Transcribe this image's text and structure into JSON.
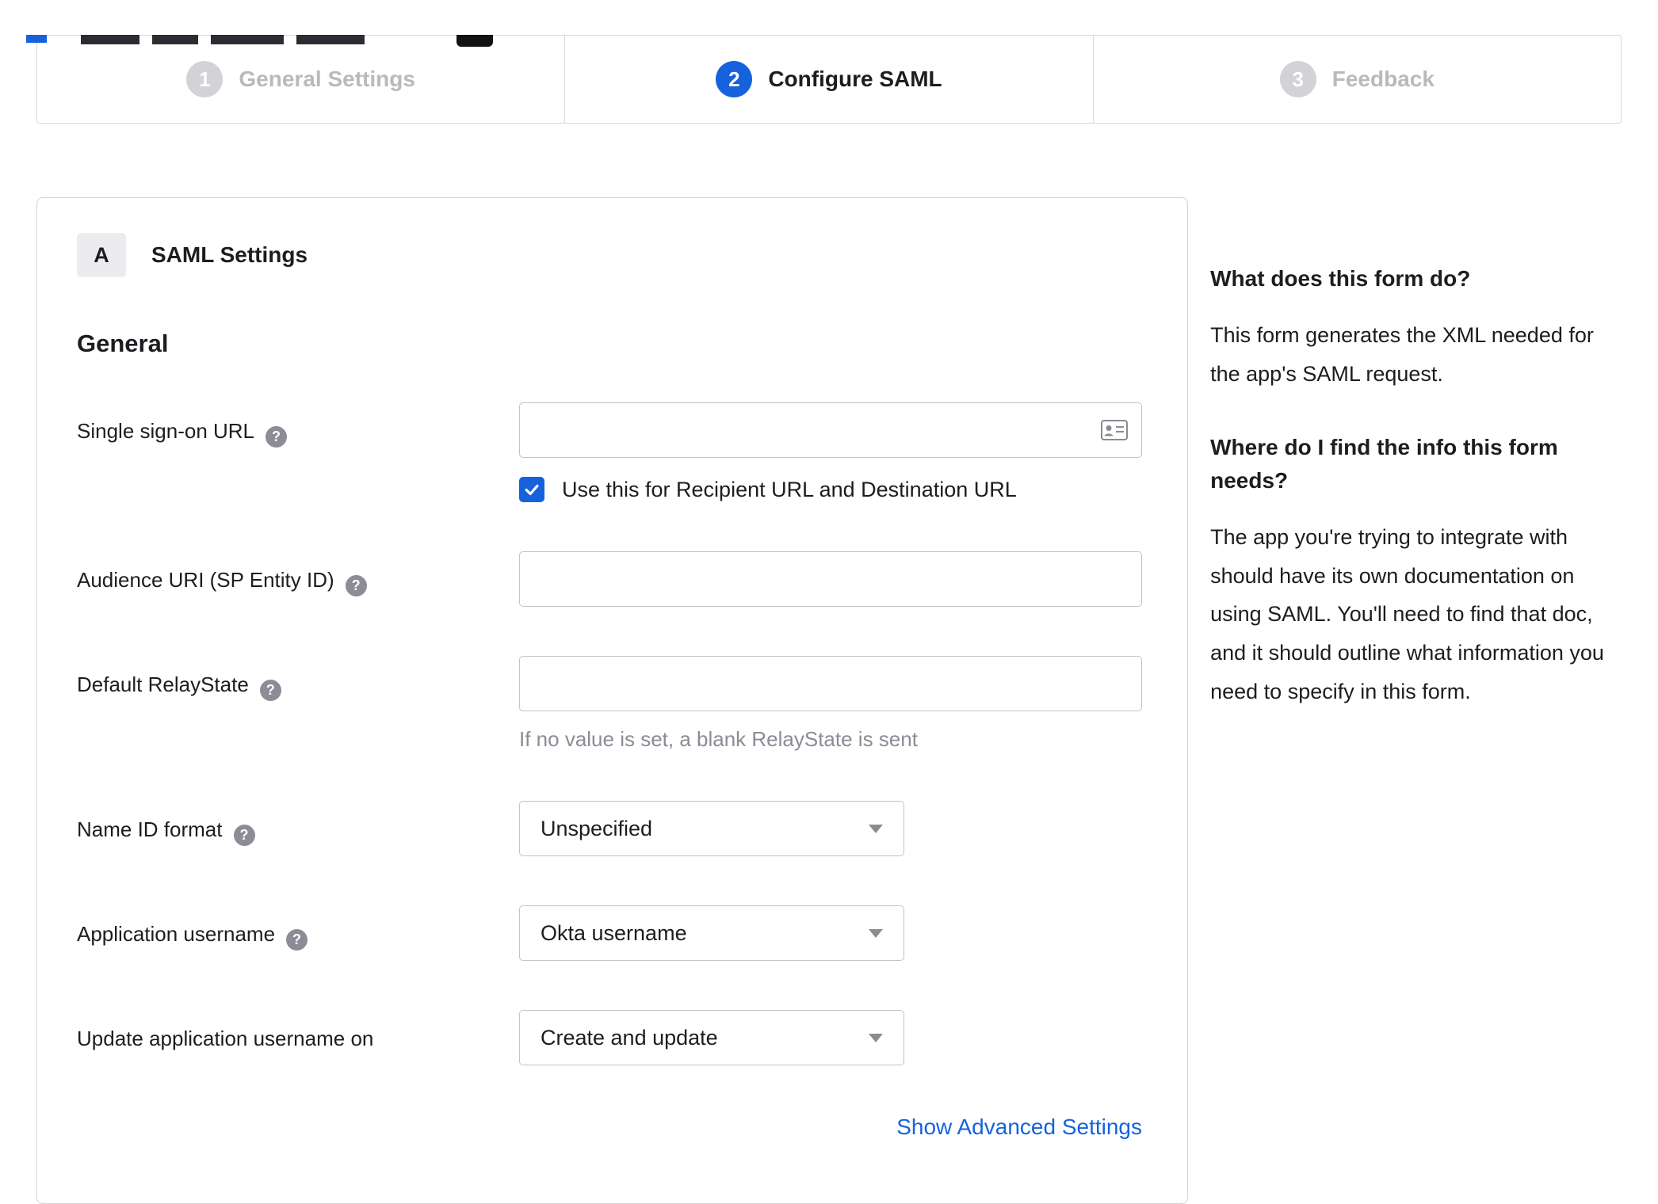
{
  "stepper": {
    "steps": [
      {
        "number": "1",
        "label": "General Settings",
        "active": false
      },
      {
        "number": "2",
        "label": "Configure SAML",
        "active": true
      },
      {
        "number": "3",
        "label": "Feedback",
        "active": false
      }
    ]
  },
  "panel": {
    "badge": "A",
    "title": "SAML Settings",
    "section_heading": "General",
    "fields": {
      "sso_url": {
        "label": "Single sign-on URL",
        "value": "",
        "checkbox_label": "Use this for Recipient URL and Destination URL",
        "checkbox_checked": true
      },
      "audience": {
        "label": "Audience URI (SP Entity ID)",
        "value": ""
      },
      "relay_state": {
        "label": "Default RelayState",
        "value": "",
        "hint": "If no value is set, a blank RelayState is sent"
      },
      "name_id": {
        "label": "Name ID format",
        "value": "Unspecified"
      },
      "app_username": {
        "label": "Application username",
        "value": "Okta username"
      },
      "update_username": {
        "label": "Update application username on",
        "value": "Create and update"
      }
    },
    "advanced_link": "Show Advanced Settings"
  },
  "help": {
    "sections": [
      {
        "heading": "What does this form do?",
        "body": "This form generates the XML needed for the app's SAML request."
      },
      {
        "heading": "Where do I find the info this form needs?",
        "body": "The app you're trying to integrate with should have its own documentation on using SAML. You'll need to find that doc, and it should outline what information you need to specify in this form."
      }
    ]
  },
  "icons": {
    "help": "?"
  },
  "colors": {
    "accent": "#1662dd",
    "inactive_circle": "#d2d2d7",
    "inactive_label": "#b9b9bf"
  }
}
